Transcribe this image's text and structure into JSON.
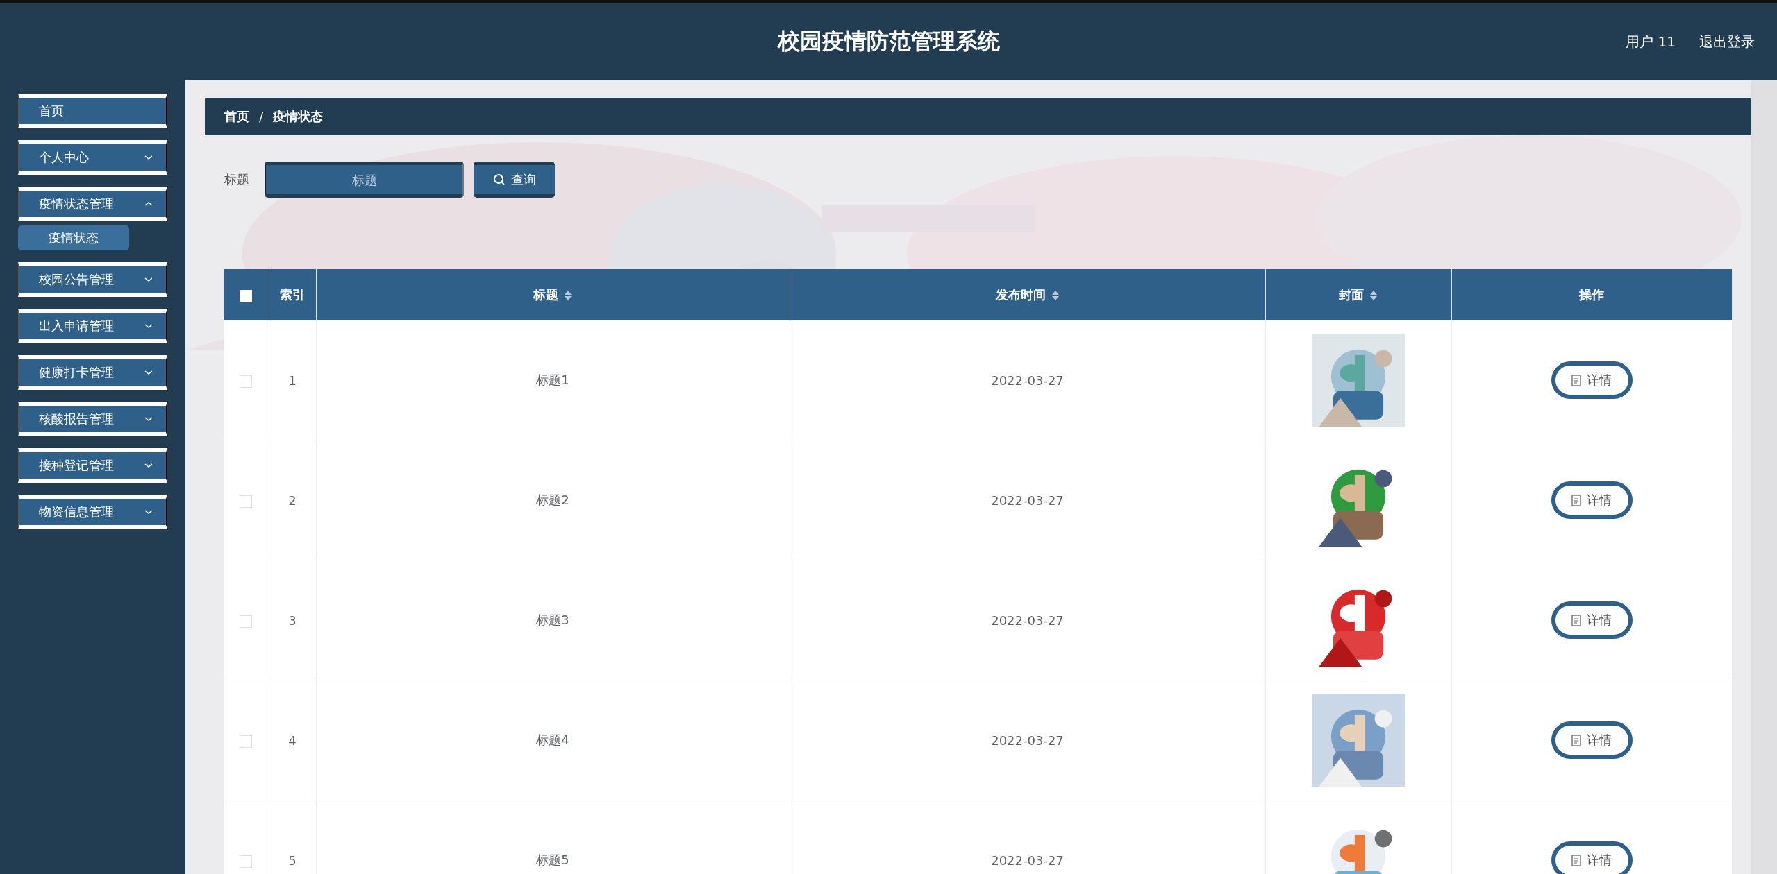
{
  "header": {
    "title": "校园疫情防范管理系统",
    "user": "用户 11",
    "logout": "退出登录"
  },
  "sidebar": {
    "items": [
      {
        "label": "首页",
        "kind": "link"
      },
      {
        "label": "个人中心",
        "kind": "menu",
        "expanded": false
      },
      {
        "label": "疫情状态管理",
        "kind": "menu",
        "expanded": true,
        "children": [
          {
            "label": "疫情状态",
            "selected": true
          }
        ]
      },
      {
        "label": "校园公告管理",
        "kind": "menu",
        "expanded": false
      },
      {
        "label": "出入申请管理",
        "kind": "menu",
        "expanded": false
      },
      {
        "label": "健康打卡管理",
        "kind": "menu",
        "expanded": false
      },
      {
        "label": "核酸报告管理",
        "kind": "menu",
        "expanded": false
      },
      {
        "label": "接种登记管理",
        "kind": "menu",
        "expanded": false
      },
      {
        "label": "物资信息管理",
        "kind": "menu",
        "expanded": false
      }
    ]
  },
  "breadcrumb": [
    "首页",
    "/",
    "疫情状态"
  ],
  "search": {
    "label": "标题",
    "placeholder": "标题",
    "button": "查询"
  },
  "table": {
    "select_all": {
      "checked": false
    },
    "columns": [
      {
        "label": "索引",
        "sortable": false
      },
      {
        "label": "标题",
        "sortable": true
      },
      {
        "label": "发布时间",
        "sortable": true
      },
      {
        "label": "封面",
        "sortable": true
      },
      {
        "label": "操作",
        "sortable": false
      }
    ],
    "rows": [
      {
        "checked": false,
        "index": "1",
        "title": "标题1",
        "date": "2022-03-27",
        "action": "详情"
      },
      {
        "checked": false,
        "index": "2",
        "title": "标题2",
        "date": "2022-03-27",
        "action": "详情"
      },
      {
        "checked": false,
        "index": "3",
        "title": "标题3",
        "date": "2022-03-27",
        "action": "详情"
      },
      {
        "checked": false,
        "index": "4",
        "title": "标题4",
        "date": "2022-03-27",
        "action": "详情"
      },
      {
        "checked": false,
        "index": "5",
        "title": "标题5",
        "date": "2022-03-27",
        "action": "详情"
      }
    ]
  }
}
